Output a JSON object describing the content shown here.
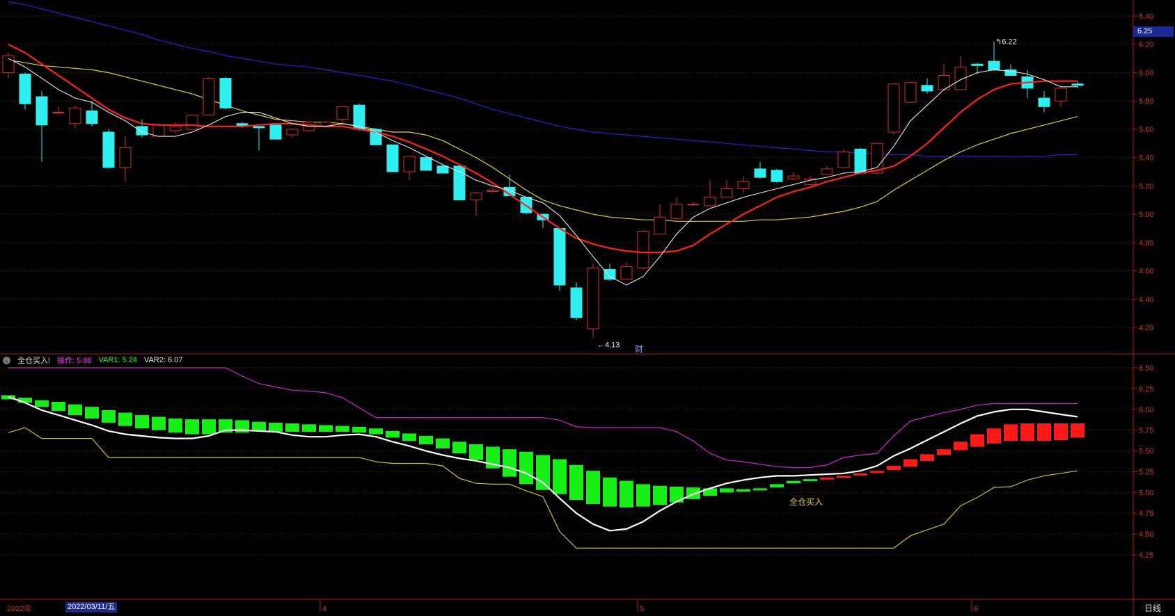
{
  "price_panel": {
    "y_ticks": [
      "6.40",
      "6.20",
      "6.00",
      "5.80",
      "5.60",
      "5.40",
      "5.20",
      "5.00",
      "4.80",
      "4.60",
      "4.40",
      "4.20"
    ],
    "current_price_label": "6.25",
    "low_annotation": "4.13",
    "high_annotation": "6.22",
    "cai_badge": "财"
  },
  "indicator_panel": {
    "name": "全仓买入!",
    "op_label": "操作: 5.88",
    "var1_label": "VAR1: 5.24",
    "var2_label": "VAR2: 6.07",
    "y_ticks": [
      "6.50",
      "6.25",
      "6.00",
      "5.75",
      "5.50",
      "5.25",
      "5.00",
      "4.75",
      "4.50",
      "4.25"
    ],
    "signal_text": "全仓买入"
  },
  "bottom_axis": {
    "year_label": "2022年",
    "cursor_date": "2022/03/11/五",
    "month_labels": [
      "4",
      "5",
      "6"
    ],
    "period_label": "日线"
  },
  "colors": {
    "up": "#e02a2a",
    "down": "#2ff0f0",
    "ma_white": "#e8e8e8",
    "ma_red": "#ff2020",
    "ma_yellow": "#d8d820",
    "ma_blue": "#2424d8",
    "grid": "#5a1010",
    "axis": "#b01818",
    "bar_green": "#16f016",
    "bar_red": "#ff1a1a",
    "band_upper": "#d025d0",
    "band_lower": "#c8c810"
  },
  "chart_data": [
    {
      "type": "candlestick",
      "title": "",
      "ylim": [
        4.1,
        6.5
      ],
      "candles": [
        [
          6.0,
          6.12,
          6.14,
          5.96
        ],
        [
          5.99,
          5.78,
          6.0,
          5.74
        ],
        [
          5.83,
          5.63,
          5.87,
          5.37
        ],
        [
          5.72,
          5.72,
          5.76,
          5.7
        ],
        [
          5.64,
          5.75,
          5.77,
          5.61
        ],
        [
          5.73,
          5.64,
          5.8,
          5.62
        ],
        [
          5.58,
          5.33,
          5.6,
          5.32
        ],
        [
          5.33,
          5.47,
          5.55,
          5.23
        ],
        [
          5.62,
          5.56,
          5.67,
          5.54
        ],
        [
          5.55,
          5.63,
          5.64,
          5.55
        ],
        [
          5.59,
          5.62,
          5.65,
          5.57
        ],
        [
          5.6,
          5.7,
          5.7,
          5.6
        ],
        [
          5.7,
          5.96,
          5.97,
          5.7
        ],
        [
          5.96,
          5.75,
          5.97,
          5.74
        ],
        [
          5.64,
          5.62,
          5.65,
          5.61
        ],
        [
          5.62,
          5.61,
          5.62,
          5.45
        ],
        [
          5.63,
          5.53,
          5.64,
          5.53
        ],
        [
          5.56,
          5.6,
          5.6,
          5.54
        ],
        [
          5.59,
          5.65,
          5.66,
          5.58
        ],
        [
          5.62,
          5.65,
          5.66,
          5.62
        ],
        [
          5.67,
          5.76,
          5.76,
          5.62
        ],
        [
          5.77,
          5.6,
          5.78,
          5.59
        ],
        [
          5.6,
          5.49,
          5.61,
          5.49
        ],
        [
          5.49,
          5.3,
          5.49,
          5.3
        ],
        [
          5.3,
          5.41,
          5.41,
          5.24
        ],
        [
          5.4,
          5.31,
          5.41,
          5.31
        ],
        [
          5.34,
          5.29,
          5.35,
          5.29
        ],
        [
          5.34,
          5.1,
          5.34,
          5.1
        ],
        [
          5.1,
          5.15,
          5.16,
          4.99
        ],
        [
          5.16,
          5.17,
          5.2,
          5.15
        ],
        [
          5.19,
          5.13,
          5.28,
          5.13
        ],
        [
          5.12,
          5.01,
          5.12,
          5.0
        ],
        [
          5.0,
          4.96,
          5.0,
          4.9
        ],
        [
          4.9,
          4.5,
          4.9,
          4.46
        ],
        [
          4.48,
          4.27,
          4.52,
          4.25
        ],
        [
          4.19,
          4.62,
          4.65,
          4.13
        ],
        [
          4.61,
          4.54,
          4.65,
          4.53
        ],
        [
          4.54,
          4.63,
          4.66,
          4.54
        ],
        [
          4.62,
          4.88,
          4.89,
          4.61
        ],
        [
          4.86,
          4.98,
          5.07,
          4.86
        ],
        [
          4.97,
          5.07,
          5.12,
          4.96
        ],
        [
          5.07,
          5.07,
          5.09,
          5.06
        ],
        [
          5.06,
          5.12,
          5.24,
          5.05
        ],
        [
          5.12,
          5.18,
          5.24,
          5.12
        ],
        [
          5.18,
          5.23,
          5.27,
          5.15
        ],
        [
          5.32,
          5.26,
          5.37,
          5.25
        ],
        [
          5.31,
          5.23,
          5.32,
          5.22
        ],
        [
          5.25,
          5.27,
          5.3,
          5.24
        ],
        [
          5.21,
          5.25,
          5.27,
          5.21
        ],
        [
          5.28,
          5.32,
          5.34,
          5.28
        ],
        [
          5.33,
          5.44,
          5.46,
          5.33
        ],
        [
          5.46,
          5.29,
          5.47,
          5.29
        ],
        [
          5.29,
          5.5,
          5.5,
          5.28
        ],
        [
          5.58,
          5.92,
          5.92,
          5.56
        ],
        [
          5.79,
          5.93,
          5.94,
          5.79
        ],
        [
          5.91,
          5.87,
          5.96,
          5.85
        ],
        [
          5.88,
          5.98,
          6.06,
          5.88
        ],
        [
          5.88,
          6.04,
          6.12,
          5.88
        ],
        [
          6.06,
          6.05,
          6.07,
          5.99
        ],
        [
          6.08,
          6.02,
          6.22,
          6.01
        ],
        [
          6.02,
          5.98,
          6.06,
          5.98
        ],
        [
          5.97,
          5.89,
          6.02,
          5.82
        ],
        [
          5.82,
          5.76,
          5.87,
          5.72
        ],
        [
          5.8,
          5.89,
          5.9,
          5.76
        ],
        [
          5.92,
          5.91,
          5.94,
          5.89
        ]
      ],
      "ma_white": [
        6.1,
        6.04,
        5.96,
        5.88,
        5.82,
        5.79,
        5.72,
        5.66,
        5.58,
        5.55,
        5.55,
        5.58,
        5.63,
        5.69,
        5.72,
        5.72,
        5.68,
        5.64,
        5.62,
        5.62,
        5.64,
        5.62,
        5.58,
        5.52,
        5.47,
        5.41,
        5.35,
        5.3,
        5.24,
        5.2,
        5.17,
        5.12,
        5.08,
        4.99,
        4.85,
        4.7,
        4.56,
        4.5,
        4.56,
        4.7,
        4.86,
        4.98,
        5.04,
        5.08,
        5.12,
        5.15,
        5.18,
        5.21,
        5.24,
        5.26,
        5.29,
        5.3,
        5.33,
        5.48,
        5.66,
        5.77,
        5.88,
        5.95,
        6.0,
        6.02,
        6.01,
        5.99,
        5.95,
        5.9,
        5.9
      ],
      "ma_red": [
        6.2,
        6.14,
        6.06,
        5.98,
        5.9,
        5.82,
        5.74,
        5.68,
        5.64,
        5.63,
        5.63,
        5.63,
        5.62,
        5.62,
        5.62,
        5.63,
        5.64,
        5.64,
        5.63,
        5.62,
        5.62,
        5.6,
        5.58,
        5.55,
        5.51,
        5.46,
        5.41,
        5.35,
        5.29,
        5.22,
        5.14,
        5.06,
        4.98,
        4.9,
        4.83,
        4.79,
        4.76,
        4.74,
        4.73,
        4.73,
        4.74,
        4.78,
        4.86,
        4.93,
        5.0,
        5.06,
        5.12,
        5.16,
        5.19,
        5.23,
        5.26,
        5.29,
        5.31,
        5.34,
        5.41,
        5.5,
        5.61,
        5.72,
        5.81,
        5.88,
        5.92,
        5.93,
        5.94,
        5.94,
        5.94
      ],
      "ma_yellow": [
        6.09,
        6.07,
        6.05,
        6.04,
        6.03,
        6.02,
        6.0,
        5.97,
        5.94,
        5.91,
        5.88,
        5.85,
        5.81,
        5.77,
        5.73,
        5.7,
        5.67,
        5.66,
        5.65,
        5.65,
        5.64,
        5.62,
        5.6,
        5.58,
        5.58,
        5.56,
        5.52,
        5.46,
        5.4,
        5.33,
        5.25,
        5.17,
        5.1,
        5.06,
        5.03,
        5.0,
        4.98,
        4.97,
        4.96,
        4.96,
        4.95,
        4.95,
        4.95,
        4.95,
        4.95,
        4.96,
        4.96,
        4.97,
        4.98,
        5.0,
        5.02,
        5.05,
        5.09,
        5.17,
        5.24,
        5.31,
        5.38,
        5.44,
        5.49,
        5.53,
        5.57,
        5.6,
        5.63,
        5.66,
        5.69
      ],
      "ma_blue": [
        6.5,
        6.48,
        6.45,
        6.42,
        6.39,
        6.36,
        6.33,
        6.3,
        6.27,
        6.23,
        6.2,
        6.17,
        6.15,
        6.12,
        6.1,
        6.08,
        6.06,
        6.05,
        6.04,
        6.02,
        6.0,
        5.98,
        5.96,
        5.94,
        5.91,
        5.88,
        5.85,
        5.82,
        5.78,
        5.74,
        5.71,
        5.68,
        5.65,
        5.62,
        5.6,
        5.58,
        5.57,
        5.56,
        5.55,
        5.54,
        5.53,
        5.52,
        5.51,
        5.5,
        5.49,
        5.48,
        5.47,
        5.46,
        5.45,
        5.44,
        5.44,
        5.43,
        5.43,
        5.42,
        5.42,
        5.41,
        5.41,
        5.41,
        5.41,
        5.41,
        5.41,
        5.41,
        5.41,
        5.42,
        5.42
      ]
    },
    {
      "type": "bar",
      "title": "全仓买入!",
      "ylim": [
        4.15,
        6.6
      ],
      "bars_top": [
        6.17,
        6.14,
        6.11,
        6.09,
        6.06,
        6.03,
        5.99,
        5.96,
        5.93,
        5.91,
        5.89,
        5.88,
        5.88,
        5.88,
        5.87,
        5.85,
        5.84,
        5.83,
        5.82,
        5.81,
        5.8,
        5.79,
        5.77,
        5.74,
        5.71,
        5.68,
        5.65,
        5.61,
        5.58,
        5.55,
        5.52,
        5.49,
        5.45,
        5.4,
        5.33,
        5.26,
        5.18,
        5.14,
        5.1,
        5.08,
        5.07,
        5.06,
        5.05,
        5.05,
        5.04,
        5.05,
        5.1,
        5.14,
        5.16,
        5.18,
        5.2,
        5.23,
        5.26,
        5.32,
        5.4,
        5.46,
        5.52,
        5.61,
        5.7,
        5.77,
        5.82,
        5.83,
        5.83,
        5.83,
        5.83
      ],
      "bars_bottom": [
        6.12,
        6.08,
        6.03,
        5.98,
        5.93,
        5.89,
        5.84,
        5.8,
        5.77,
        5.75,
        5.72,
        5.7,
        5.7,
        5.72,
        5.72,
        5.74,
        5.73,
        5.73,
        5.73,
        5.73,
        5.73,
        5.72,
        5.7,
        5.66,
        5.62,
        5.58,
        5.53,
        5.47,
        5.39,
        5.29,
        5.19,
        5.1,
        5.03,
        4.98,
        4.91,
        4.86,
        4.83,
        4.82,
        4.83,
        4.85,
        4.88,
        4.92,
        4.96,
        5.0,
        5.01,
        5.04,
        5.06,
        5.11,
        5.14,
        5.16,
        5.18,
        5.21,
        5.24,
        5.27,
        5.31,
        5.38,
        5.45,
        5.51,
        5.55,
        5.59,
        5.62,
        5.62,
        5.62,
        5.63,
        5.66
      ],
      "series": [
        {
          "name": "VAR2",
          "values": [
            6.15,
            6.08,
            5.99,
            5.93,
            5.87,
            5.81,
            5.74,
            5.7,
            5.68,
            5.66,
            5.65,
            5.65,
            5.68,
            5.75,
            5.75,
            5.74,
            5.73,
            5.69,
            5.67,
            5.67,
            5.69,
            5.7,
            5.67,
            5.61,
            5.56,
            5.5,
            5.45,
            5.41,
            5.38,
            5.34,
            5.3,
            5.23,
            5.12,
            4.93,
            4.75,
            4.62,
            4.54,
            4.56,
            4.65,
            4.78,
            4.89,
            4.98,
            5.05,
            5.11,
            5.15,
            5.18,
            5.2,
            5.2,
            5.21,
            5.22,
            5.23,
            5.26,
            5.32,
            5.44,
            5.53,
            5.63,
            5.73,
            5.83,
            5.92,
            5.97,
            6.0,
            6.0,
            5.97,
            5.94,
            5.91
          ]
        },
        {
          "name": "upper",
          "values": [
            6.5,
            6.5,
            6.5,
            6.5,
            6.5,
            6.5,
            6.5,
            6.5,
            6.5,
            6.5,
            6.5,
            6.5,
            6.5,
            6.5,
            6.4,
            6.31,
            6.27,
            6.23,
            6.22,
            6.2,
            6.14,
            6.02,
            5.9,
            5.9,
            5.9,
            5.9,
            5.9,
            5.9,
            5.9,
            5.9,
            5.9,
            5.9,
            5.9,
            5.87,
            5.79,
            5.78,
            5.78,
            5.78,
            5.78,
            5.78,
            5.73,
            5.62,
            5.47,
            5.39,
            5.37,
            5.34,
            5.31,
            5.3,
            5.3,
            5.33,
            5.42,
            5.45,
            5.47,
            5.68,
            5.86,
            5.91,
            5.96,
            6.0,
            6.05,
            6.07,
            6.07,
            6.07,
            6.07,
            6.07,
            6.07
          ]
        },
        {
          "name": "lower",
          "values": [
            5.72,
            5.78,
            5.65,
            5.65,
            5.65,
            5.65,
            5.42,
            5.42,
            5.42,
            5.42,
            5.42,
            5.42,
            5.42,
            5.42,
            5.42,
            5.42,
            5.42,
            5.42,
            5.42,
            5.42,
            5.42,
            5.42,
            5.37,
            5.35,
            5.35,
            5.35,
            5.32,
            5.17,
            5.11,
            5.1,
            5.1,
            5.02,
            4.95,
            4.53,
            4.33,
            4.33,
            4.33,
            4.33,
            4.33,
            4.33,
            4.33,
            4.33,
            4.33,
            4.33,
            4.33,
            4.33,
            4.33,
            4.33,
            4.33,
            4.33,
            4.33,
            4.33,
            4.33,
            4.33,
            4.48,
            4.55,
            4.62,
            4.84,
            4.94,
            5.06,
            5.07,
            5.15,
            5.2,
            5.23,
            5.26
          ]
        }
      ]
    }
  ]
}
